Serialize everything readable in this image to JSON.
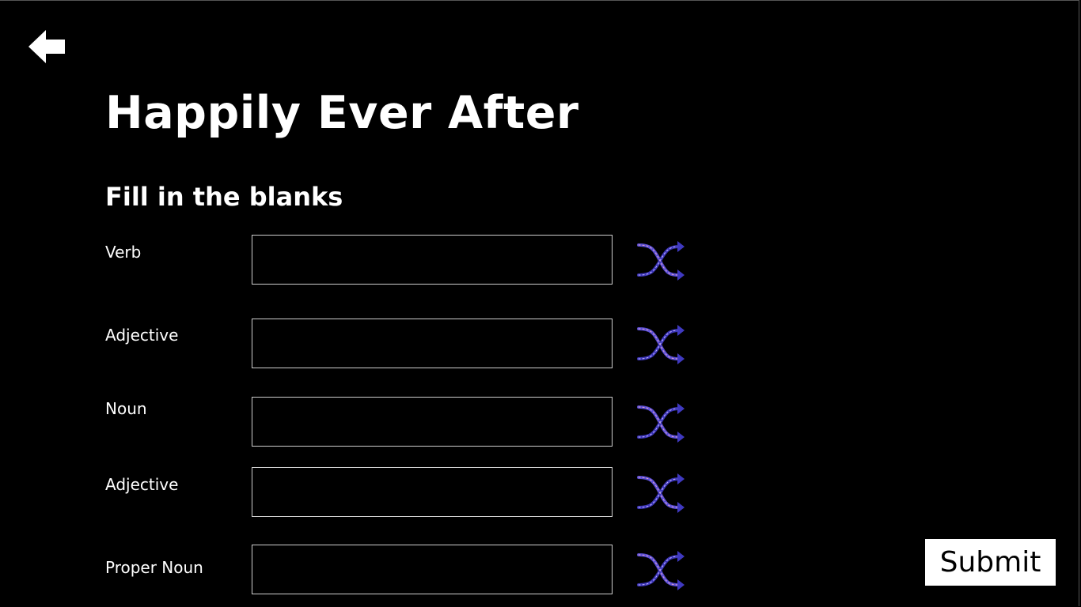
{
  "header": {
    "back_icon": "arrow-left-icon"
  },
  "main": {
    "title": "Happily Ever After",
    "subtitle": "Fill in the blanks",
    "fields": [
      {
        "label": "Verb",
        "value": ""
      },
      {
        "label": "Adjective",
        "value": ""
      },
      {
        "label": "Noun",
        "value": ""
      },
      {
        "label": "Adjective",
        "value": ""
      },
      {
        "label": "Proper Noun",
        "value": ""
      }
    ],
    "shuffle_icon": "shuffle-icon"
  },
  "footer": {
    "submit_label": "Submit"
  },
  "colors": {
    "background": "#000000",
    "text": "#ffffff",
    "field_border": "#cfcfcf",
    "shuffle_accent": "#4b3fc7"
  }
}
